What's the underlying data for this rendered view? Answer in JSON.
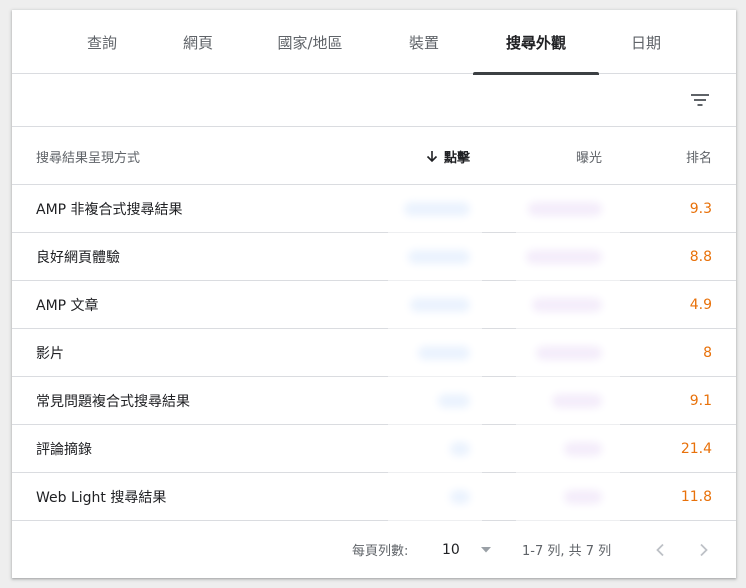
{
  "tabs": [
    {
      "label": "查詢"
    },
    {
      "label": "網頁"
    },
    {
      "label": "國家/地區"
    },
    {
      "label": "裝置"
    },
    {
      "label": "搜尋外觀",
      "active": true
    },
    {
      "label": "日期"
    }
  ],
  "table": {
    "headers": {
      "appearance": "搜尋結果呈現方式",
      "clicks": "點擊",
      "impressions": "曝光",
      "position": "排名"
    },
    "sort": {
      "column": "clicks",
      "direction": "descending"
    },
    "rows": [
      {
        "name": "AMP 非複合式搜尋結果",
        "position": "9.3"
      },
      {
        "name": "良好網頁體驗",
        "position": "8.8"
      },
      {
        "name": "AMP 文章",
        "position": "4.9"
      },
      {
        "name": "影片",
        "position": "8"
      },
      {
        "name": "常見問題複合式搜尋結果",
        "position": "9.1"
      },
      {
        "name": "評論摘錄",
        "position": "21.4"
      },
      {
        "name": "Web Light 搜尋結果",
        "position": "11.8"
      }
    ]
  },
  "footer": {
    "rows_per_page_label": "每頁列數:",
    "rows_per_page_value": "10",
    "range_text": "1-7 列,  共 7 列"
  },
  "icons": {
    "filter": "filter-icon",
    "sort_arrow": "arrow-down-icon",
    "dropdown": "dropdown-arrow-icon",
    "prev": "chevron-left-icon",
    "next": "chevron-right-icon"
  },
  "colors": {
    "position_value": "#e8710a",
    "tab_indicator": "#3c4043",
    "divider": "#dadce0"
  }
}
